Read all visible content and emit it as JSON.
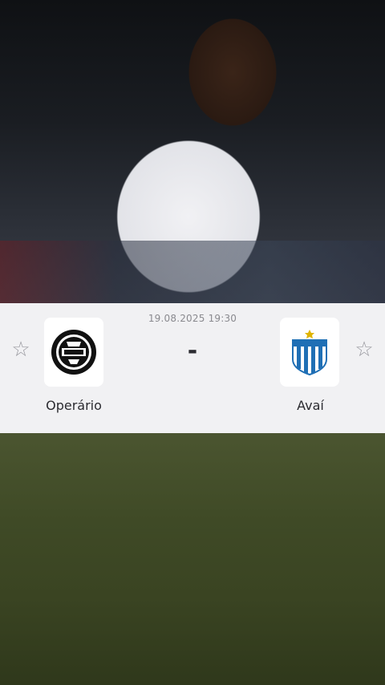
{
  "match": {
    "datetime": "19.08.2025 19:30",
    "score": "-",
    "home_team": "Operário",
    "away_team": "Avaí"
  },
  "icons": {
    "favorite_left": "star-outline-icon",
    "favorite_right": "star-outline-icon",
    "home_crest": "operario-crest-icon",
    "away_crest": "avai-crest-icon"
  },
  "colors": {
    "card_background": "#f1f1f3",
    "text_primary": "#2b2b30",
    "text_secondary": "#8a8a8f",
    "avai_blue": "#1f6fb5"
  }
}
